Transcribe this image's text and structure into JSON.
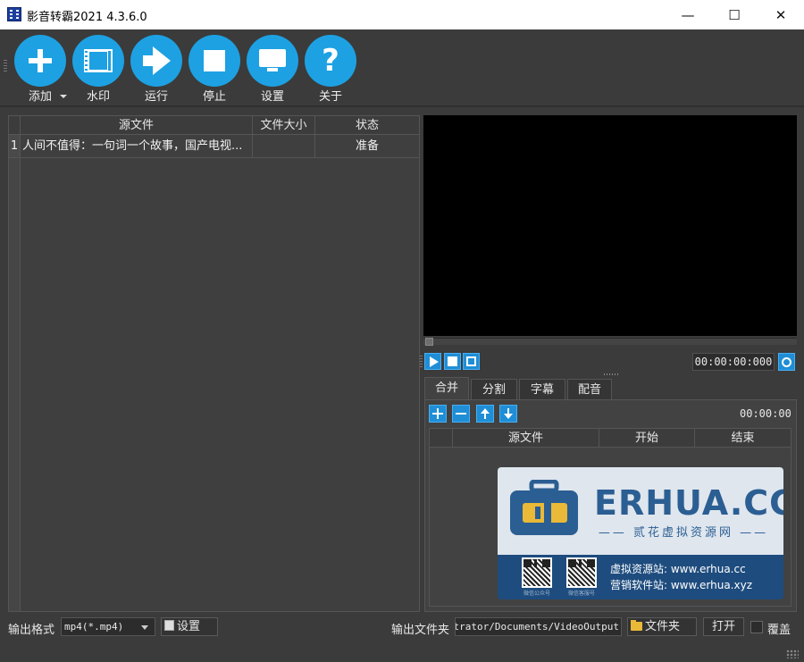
{
  "window": {
    "title": "影音转霸2021 4.3.6.0",
    "controls": {
      "minimize": "—",
      "maximize": "☐",
      "close": "✕"
    }
  },
  "toolbar": {
    "items": [
      {
        "id": "add",
        "label": "添加",
        "icon": "plus-icon"
      },
      {
        "id": "watermark",
        "label": "水印",
        "icon": "film-icon"
      },
      {
        "id": "run",
        "label": "运行",
        "icon": "arrow-right-icon"
      },
      {
        "id": "stop",
        "label": "停止",
        "icon": "stop-icon"
      },
      {
        "id": "settings",
        "label": "设置",
        "icon": "monitor-icon"
      },
      {
        "id": "about",
        "label": "关于",
        "icon": "question-icon"
      }
    ],
    "about_glyph": "?"
  },
  "file_table": {
    "columns": [
      "源文件",
      "文件大小",
      "状态"
    ],
    "rows": [
      {
        "index": "1",
        "source": "人间不值得：一句词一个故事，国产电视...",
        "size": "",
        "status": "准备"
      }
    ]
  },
  "player": {
    "time": "00:00:00:000"
  },
  "tabs": {
    "items": [
      "合并",
      "分割",
      "字幕",
      "配音"
    ],
    "active": "合并"
  },
  "merge": {
    "time": "00:00:00",
    "columns": [
      "源文件",
      "开始",
      "结束"
    ]
  },
  "watermark_overlay": {
    "brand": "ERHUA.CC",
    "slogan": "—— 贰花虚拟资源网 ——",
    "line1": "虚拟资源站: www.erhua.cc",
    "line2": "营销软件站: www.erhua.xyz",
    "qr1_caption": "微信公众号",
    "qr2_caption": "微信客服号",
    "colors": {
      "light": "#dfe6ee",
      "dark": "#1e4c7e",
      "accent": "#e9b937"
    }
  },
  "bottom": {
    "format_label": "输出格式",
    "format_value": "mp4(*.mp4)",
    "format_settings": "设置",
    "outdir_label": "输出文件夹",
    "outdir_value": "C:/Users/Administrator/Documents/VideoOutput",
    "folder_button": "文件夹",
    "open_button": "打开",
    "overwrite_label": "覆盖"
  },
  "colors": {
    "accent": "#1da1e2",
    "background": "#3b3b3b"
  }
}
